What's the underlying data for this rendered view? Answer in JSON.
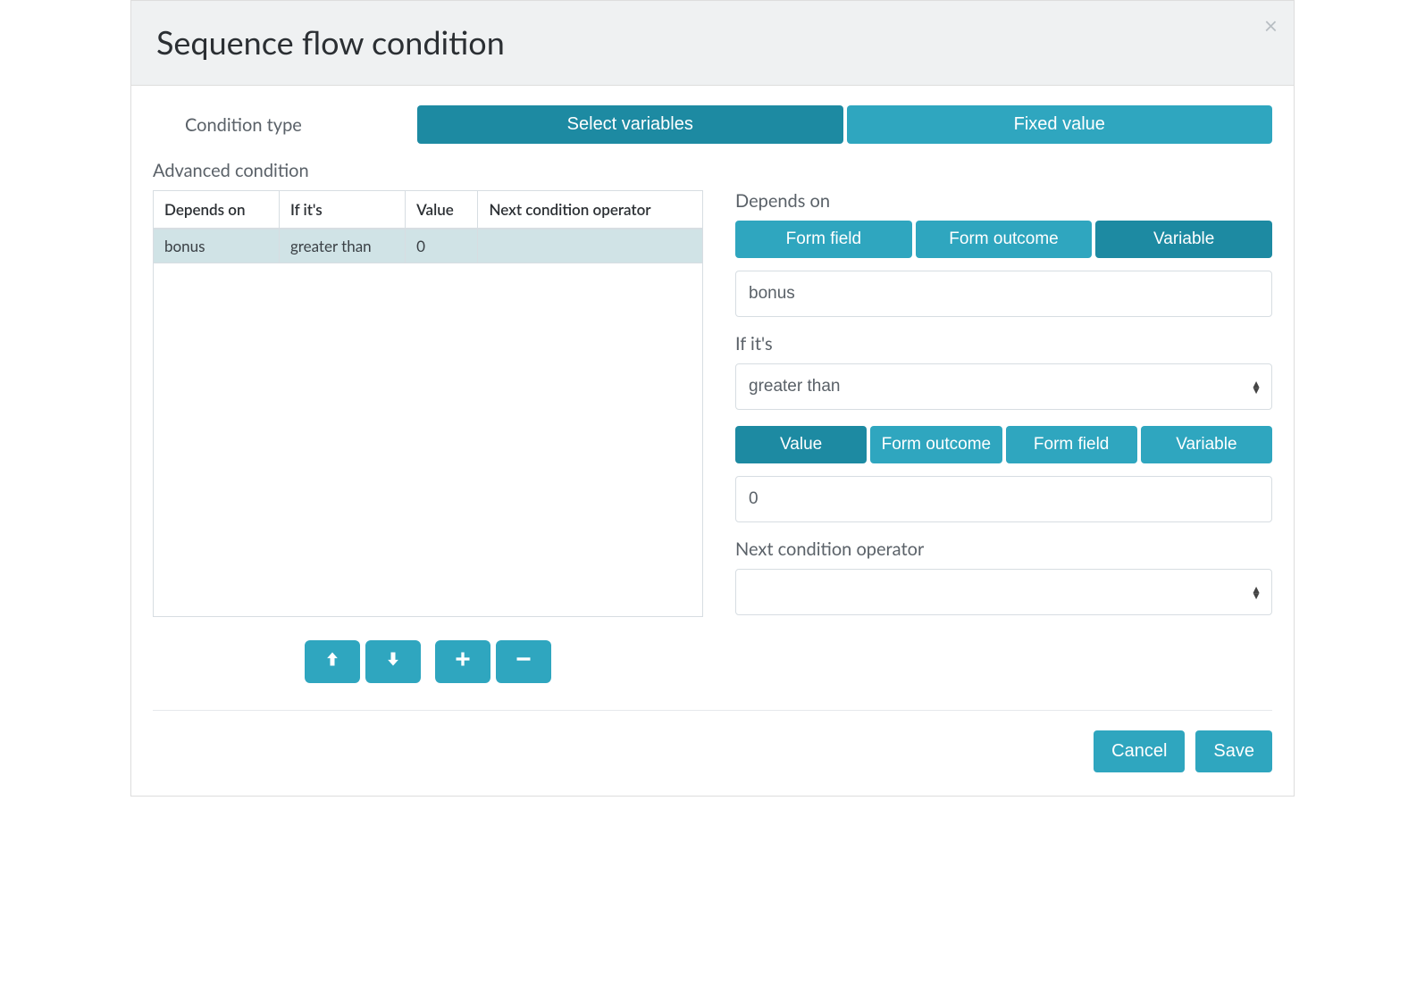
{
  "modal": {
    "title": "Sequence flow condition"
  },
  "condition_type": {
    "label": "Condition type",
    "options": [
      "Select variables",
      "Fixed value"
    ],
    "active_index": 0
  },
  "advanced": {
    "label": "Advanced condition",
    "headers": [
      "Depends on",
      "If it's",
      "Value",
      "Next condition operator"
    ],
    "rows": [
      {
        "depends_on": "bonus",
        "if": "greater than",
        "value": "0",
        "next_op": ""
      }
    ],
    "selected_row_index": 0
  },
  "form": {
    "depends_on": {
      "label": "Depends on",
      "segments": [
        "Form field",
        "Form outcome",
        "Variable"
      ],
      "active_index": 2,
      "value": "bonus"
    },
    "if": {
      "label": "If it's",
      "value": "greater than"
    },
    "value_source": {
      "segments": [
        "Value",
        "Form outcome",
        "Form field",
        "Variable"
      ],
      "active_index": 0,
      "value": "0"
    },
    "next_op": {
      "label": "Next condition operator",
      "value": ""
    }
  },
  "footer": {
    "cancel": "Cancel",
    "save": "Save"
  }
}
